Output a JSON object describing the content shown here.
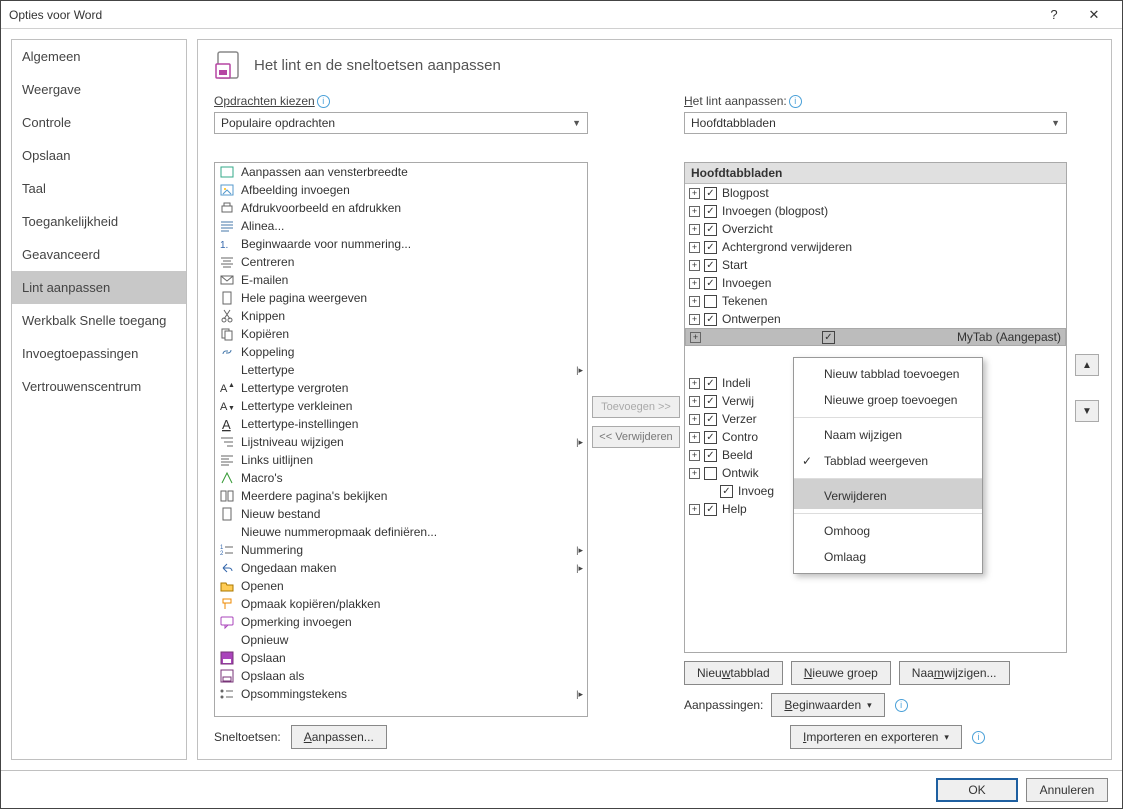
{
  "title": "Opties voor Word",
  "sidebar": {
    "items": [
      "Algemeen",
      "Weergave",
      "Controle",
      "Opslaan",
      "Taal",
      "Toegankelijkheid",
      "Geavanceerd",
      "Lint aanpassen",
      "Werkbalk Snelle toegang",
      "Invoegtoepassingen",
      "Vertrouwenscentrum"
    ],
    "selected": "Lint aanpassen"
  },
  "header": "Het lint en de sneltoetsen aanpassen",
  "left": {
    "label": "Opdrachten kiezen",
    "combo": "Populaire opdrachten",
    "items": [
      {
        "t": "Aanpassen aan vensterbreedte",
        "i": "fit"
      },
      {
        "t": "Afbeelding invoegen",
        "i": "pic"
      },
      {
        "t": "Afdrukvoorbeeld en afdrukken",
        "i": "print"
      },
      {
        "t": "Alinea...",
        "i": "para"
      },
      {
        "t": "Beginwaarde voor nummering...",
        "i": "numstart"
      },
      {
        "t": "Centreren",
        "i": "center"
      },
      {
        "t": "E-mailen",
        "i": "mail"
      },
      {
        "t": "Hele pagina weergeven",
        "i": "page"
      },
      {
        "t": "Knippen",
        "i": "cut"
      },
      {
        "t": "Kopiëren",
        "i": "copy"
      },
      {
        "t": "Koppeling",
        "i": "link"
      },
      {
        "t": "Lettertype",
        "i": "font",
        "split": true
      },
      {
        "t": "Lettertype vergroten",
        "i": "fontup"
      },
      {
        "t": "Lettertype verkleinen",
        "i": "fontdn"
      },
      {
        "t": "Lettertype-instellingen",
        "i": "fontset"
      },
      {
        "t": "Lijstniveau wijzigen",
        "i": "listlvl",
        "split": true
      },
      {
        "t": "Links uitlijnen",
        "i": "left"
      },
      {
        "t": "Macro's",
        "i": "macro"
      },
      {
        "t": "Meerdere pagina's bekijken",
        "i": "multi"
      },
      {
        "t": "Nieuw bestand",
        "i": "new"
      },
      {
        "t": "Nieuwe nummeropmaak definiëren...",
        "i": "numdef"
      },
      {
        "t": "Nummering",
        "i": "num",
        "split": true
      },
      {
        "t": "Ongedaan maken",
        "i": "undo",
        "split": true
      },
      {
        "t": "Openen",
        "i": "open"
      },
      {
        "t": "Opmaak kopiëren/plakken",
        "i": "fmtcopy"
      },
      {
        "t": "Opmerking invoegen",
        "i": "comment"
      },
      {
        "t": "Opnieuw",
        "i": "redo"
      },
      {
        "t": "Opslaan",
        "i": "save"
      },
      {
        "t": "Opslaan als",
        "i": "saveas"
      },
      {
        "t": "Opsommingstekens",
        "i": "bullets",
        "split": true
      }
    ]
  },
  "mid": {
    "add": "Toevoegen >>",
    "remove": "<< Verwijderen"
  },
  "right": {
    "label": "Het lint aanpassen:",
    "combo": "Hoofdtabbladen",
    "head": "Hoofdtabbladen",
    "items": [
      {
        "t": "Blogpost",
        "c": true
      },
      {
        "t": "Invoegen (blogpost)",
        "c": true
      },
      {
        "t": "Overzicht",
        "c": true
      },
      {
        "t": "Achtergrond verwijderen",
        "c": true
      },
      {
        "t": "Start",
        "c": true
      },
      {
        "t": "Invoegen",
        "c": true
      },
      {
        "t": "Tekenen",
        "c": false
      },
      {
        "t": "Ontwerpen",
        "c": true
      },
      {
        "t": "MyTab (Aangepast)",
        "c": true,
        "sel": true
      },
      {
        "t": "Indeli",
        "c": true
      },
      {
        "t": "Verwij",
        "c": true
      },
      {
        "t": "Verzer",
        "c": true
      },
      {
        "t": "Contro",
        "c": true
      },
      {
        "t": "Beeld",
        "c": true
      },
      {
        "t": "Ontwik",
        "c": false
      },
      {
        "t": "Invoeg",
        "c": true,
        "indent": 1,
        "noexp": true
      },
      {
        "t": "Help",
        "c": true
      }
    ]
  },
  "ctx": {
    "items": [
      "Nieuw tabblad toevoegen",
      "Nieuwe groep toevoegen",
      "Naam wijzigen",
      "Tabblad weergeven",
      "Verwijderen",
      "Omhoog",
      "Omlaag"
    ],
    "checked": "Tabblad weergeven",
    "selected": "Verwijderen"
  },
  "buttons": {
    "newTab": "Nieuw tabblad",
    "newGroup": "Nieuwe groep",
    "rename": "Naam wijzigen...",
    "custom": "Aanpassingen:",
    "reset": "Beginwaarden",
    "impexp": "Importeren en exporteren",
    "shortcuts": "Sneltoetsen:",
    "customize": "Aanpassen...",
    "ok": "OK",
    "cancel": "Annuleren"
  }
}
